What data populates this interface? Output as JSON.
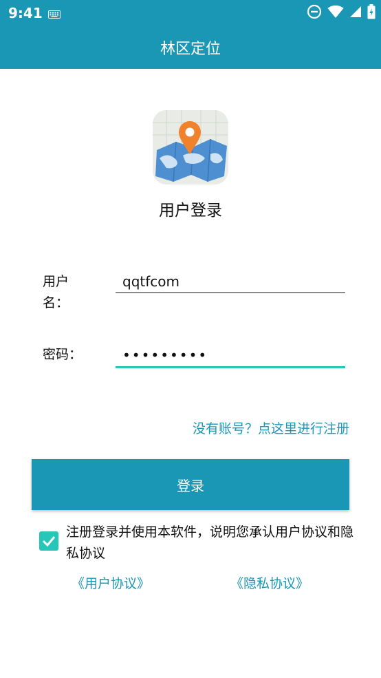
{
  "status_bar": {
    "time": "9:41",
    "icons": [
      "keyboard-icon",
      "do-not-disturb-icon",
      "wifi-icon",
      "signal-icon",
      "battery-icon"
    ]
  },
  "app_bar": {
    "title": "林区定位"
  },
  "login": {
    "logo_icon": "map-location-pin-icon",
    "title": "用户登录",
    "username_label": "用户名：",
    "username_value": "qqtfcom",
    "password_label": "密码：",
    "password_value": "•••••••••",
    "register_link": "没有账号？点这里进行注册",
    "login_button": "登录"
  },
  "agreement": {
    "checked": true,
    "text": "注册登录并使用本软件，说明您承认用户协议和隐私协议",
    "user_agreement_link": "《用户协议》",
    "privacy_agreement_link": "《隐私协议》"
  },
  "colors": {
    "primary": "#1a97b4",
    "accent": "#26c6b8"
  }
}
